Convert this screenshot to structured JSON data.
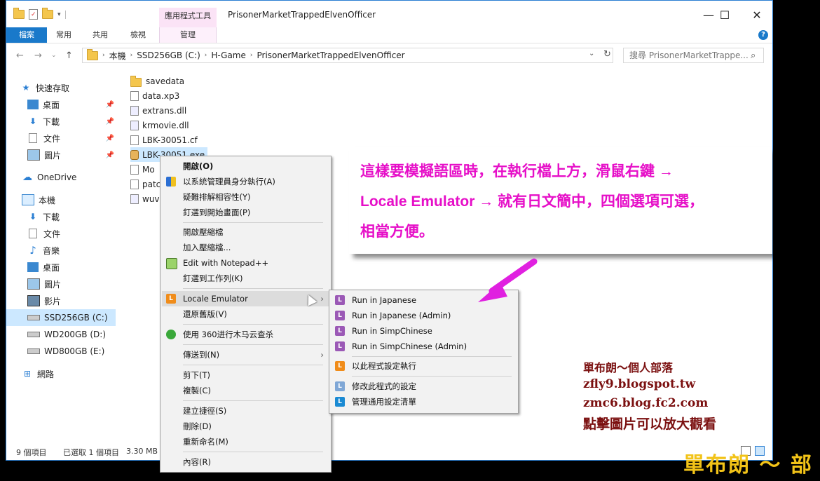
{
  "window": {
    "title": "PrisonerMarketTrappedElvenOfficer",
    "context_tab_title": "應用程式工具",
    "controls": {
      "minimize": "—",
      "maximize": "☐",
      "close": "✕"
    }
  },
  "ribbon": {
    "tabs": [
      "檔案",
      "常用",
      "共用",
      "檢視",
      "管理"
    ],
    "help": "?"
  },
  "address": {
    "segments": [
      "本機",
      "SSD256GB (C:)",
      "H-Game",
      "PrisonerMarketTrappedElvenOfficer"
    ],
    "search_placeholder": "搜尋 PrisonerMarketTrappe..."
  },
  "sidebar": {
    "quick_access": "快速存取",
    "quick_items": [
      "桌面",
      "下載",
      "文件",
      "圖片"
    ],
    "onedrive": "OneDrive",
    "this_pc": "本機",
    "pc_items": [
      "下載",
      "文件",
      "音樂",
      "桌面",
      "圖片",
      "影片",
      "SSD256GB (C:)",
      "WD200GB (D:)",
      "WD800GB (E:)"
    ],
    "network": "網路"
  },
  "files": [
    "savedata",
    "data.xp3",
    "extrans.dll",
    "krmovie.dll",
    "LBK-30051.cf",
    "LBK-30051.exe",
    "Mo",
    "patc",
    "wuv"
  ],
  "status": {
    "count": "9 個項目",
    "selected": "已選取 1 個項目",
    "size": "3.30 MB"
  },
  "context_menu": {
    "items": [
      "開啟(O)",
      "以系統管理員身分執行(A)",
      "疑難排解相容性(Y)",
      "釘選到開始畫面(P)",
      "開啟壓縮檔",
      "加入壓縮檔...",
      "Edit with Notepad++",
      "釘選到工作列(K)",
      "Locale Emulator",
      "還原舊版(V)",
      "使用 360进行木马云查杀",
      "傳送到(N)",
      "剪下(T)",
      "複製(C)",
      "建立捷徑(S)",
      "刪除(D)",
      "重新命名(M)",
      "內容(R)"
    ]
  },
  "submenu": {
    "items": [
      "Run in Japanese",
      "Run in Japanese (Admin)",
      "Run in SimpChinese",
      "Run in SimpChinese (Admin)",
      "以此程式設定執行",
      "修改此程式的設定",
      "管理通用設定清單"
    ],
    "icon_letter": "L"
  },
  "callout": {
    "line1": "這樣要模擬語區時，在執行檔上方，滑鼠右鍵 →",
    "line2": "Locale Emulator → 就有日文簡中，四個選項可選，",
    "line3": "相當方便。"
  },
  "watermark": {
    "name": "單布朗～個人部落",
    "url1": "zfly9.blogspot.tw",
    "url2": "zmc6.blog.fc2.com",
    "note": "點擊圖片可以放大觀看",
    "footer": "單布朗 ～ 部"
  },
  "colors": {
    "accent": "#1979ca",
    "callout_text": "#e60fc8",
    "blog_text": "#7b1010",
    "footer": "#f2c318",
    "arrow": "#e020e0"
  }
}
